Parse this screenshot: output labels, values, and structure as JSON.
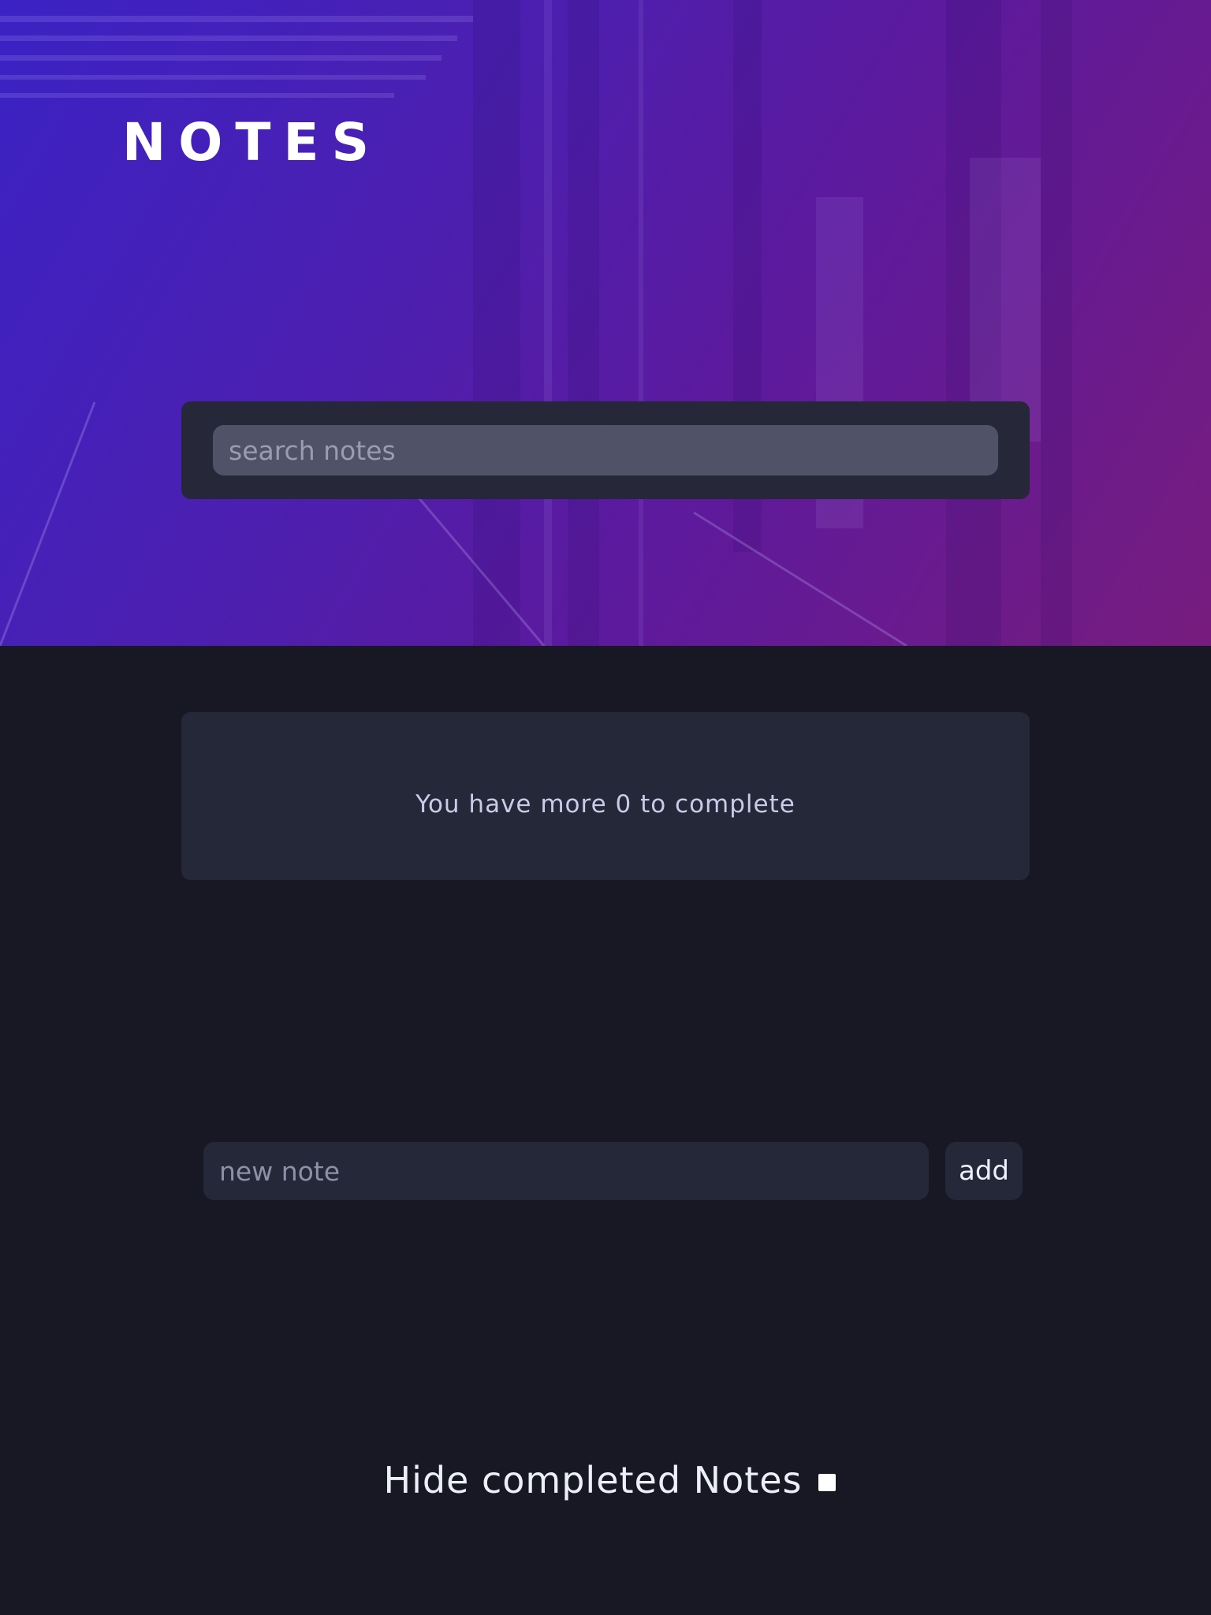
{
  "header": {
    "title": "NOTES"
  },
  "search": {
    "placeholder": "search notes",
    "value": ""
  },
  "counter": {
    "text": "You have more 0 to complete"
  },
  "new_note": {
    "placeholder": "new note",
    "value": "",
    "add_label": "add"
  },
  "filter": {
    "hide_completed_label": "Hide completed Notes",
    "hide_completed_checked": false
  },
  "colors": {
    "page_background": "#181824",
    "card_background": "#252839",
    "hero_gradient_start": "#3b22c4",
    "hero_gradient_end": "#771c7e",
    "counter_text": "#c9cbe9"
  }
}
